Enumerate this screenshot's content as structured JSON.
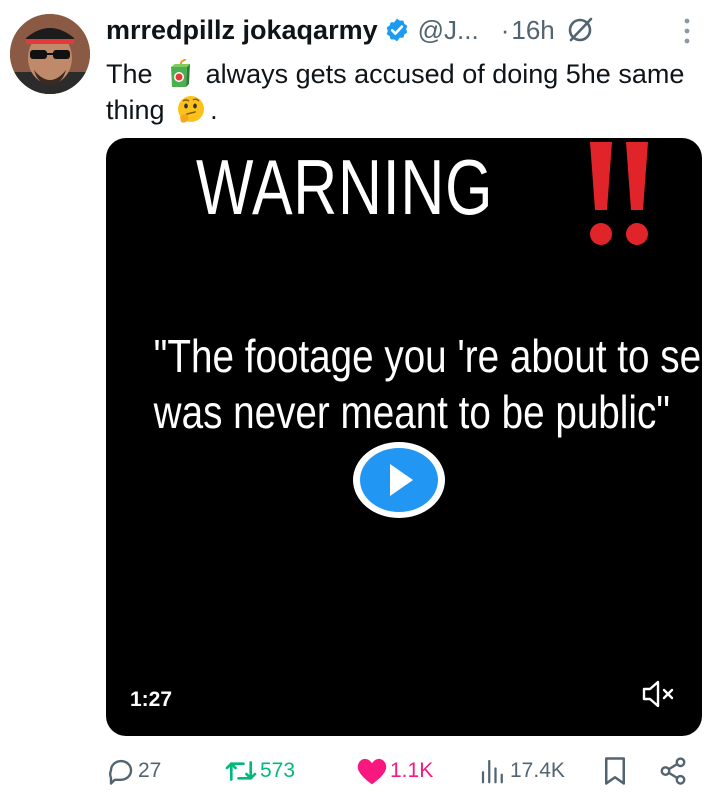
{
  "author": {
    "display_name": "mrredpillz jokaqarmy",
    "handle": "@J...",
    "separator": "·",
    "time": "16h"
  },
  "tweet": {
    "text_part1": "The",
    "text_part2": "always gets accused of doing 5he same thing",
    "text_end": "."
  },
  "media": {
    "warning_title": "WARNING",
    "quote_line1": "\"The footage you 're about to see",
    "quote_line2": "was never meant to be public\"",
    "duration": "1:27"
  },
  "actions": {
    "replies": "27",
    "reposts": "573",
    "likes": "1.1K",
    "views": "17.4K"
  },
  "icons": [
    "verified-badge-icon",
    "grok-icon",
    "more-icon",
    "juice-box-emoji",
    "thinking-face-emoji",
    "play-icon",
    "mute-icon",
    "reply-icon",
    "retweet-icon",
    "heart-icon",
    "views-icon",
    "bookmark-icon",
    "share-icon"
  ],
  "colors": {
    "verified": "#1d9bf0",
    "retweet": "#00ba7c",
    "like": "#f91880",
    "muted_text": "#536471",
    "warning_red": "#e0242a"
  }
}
